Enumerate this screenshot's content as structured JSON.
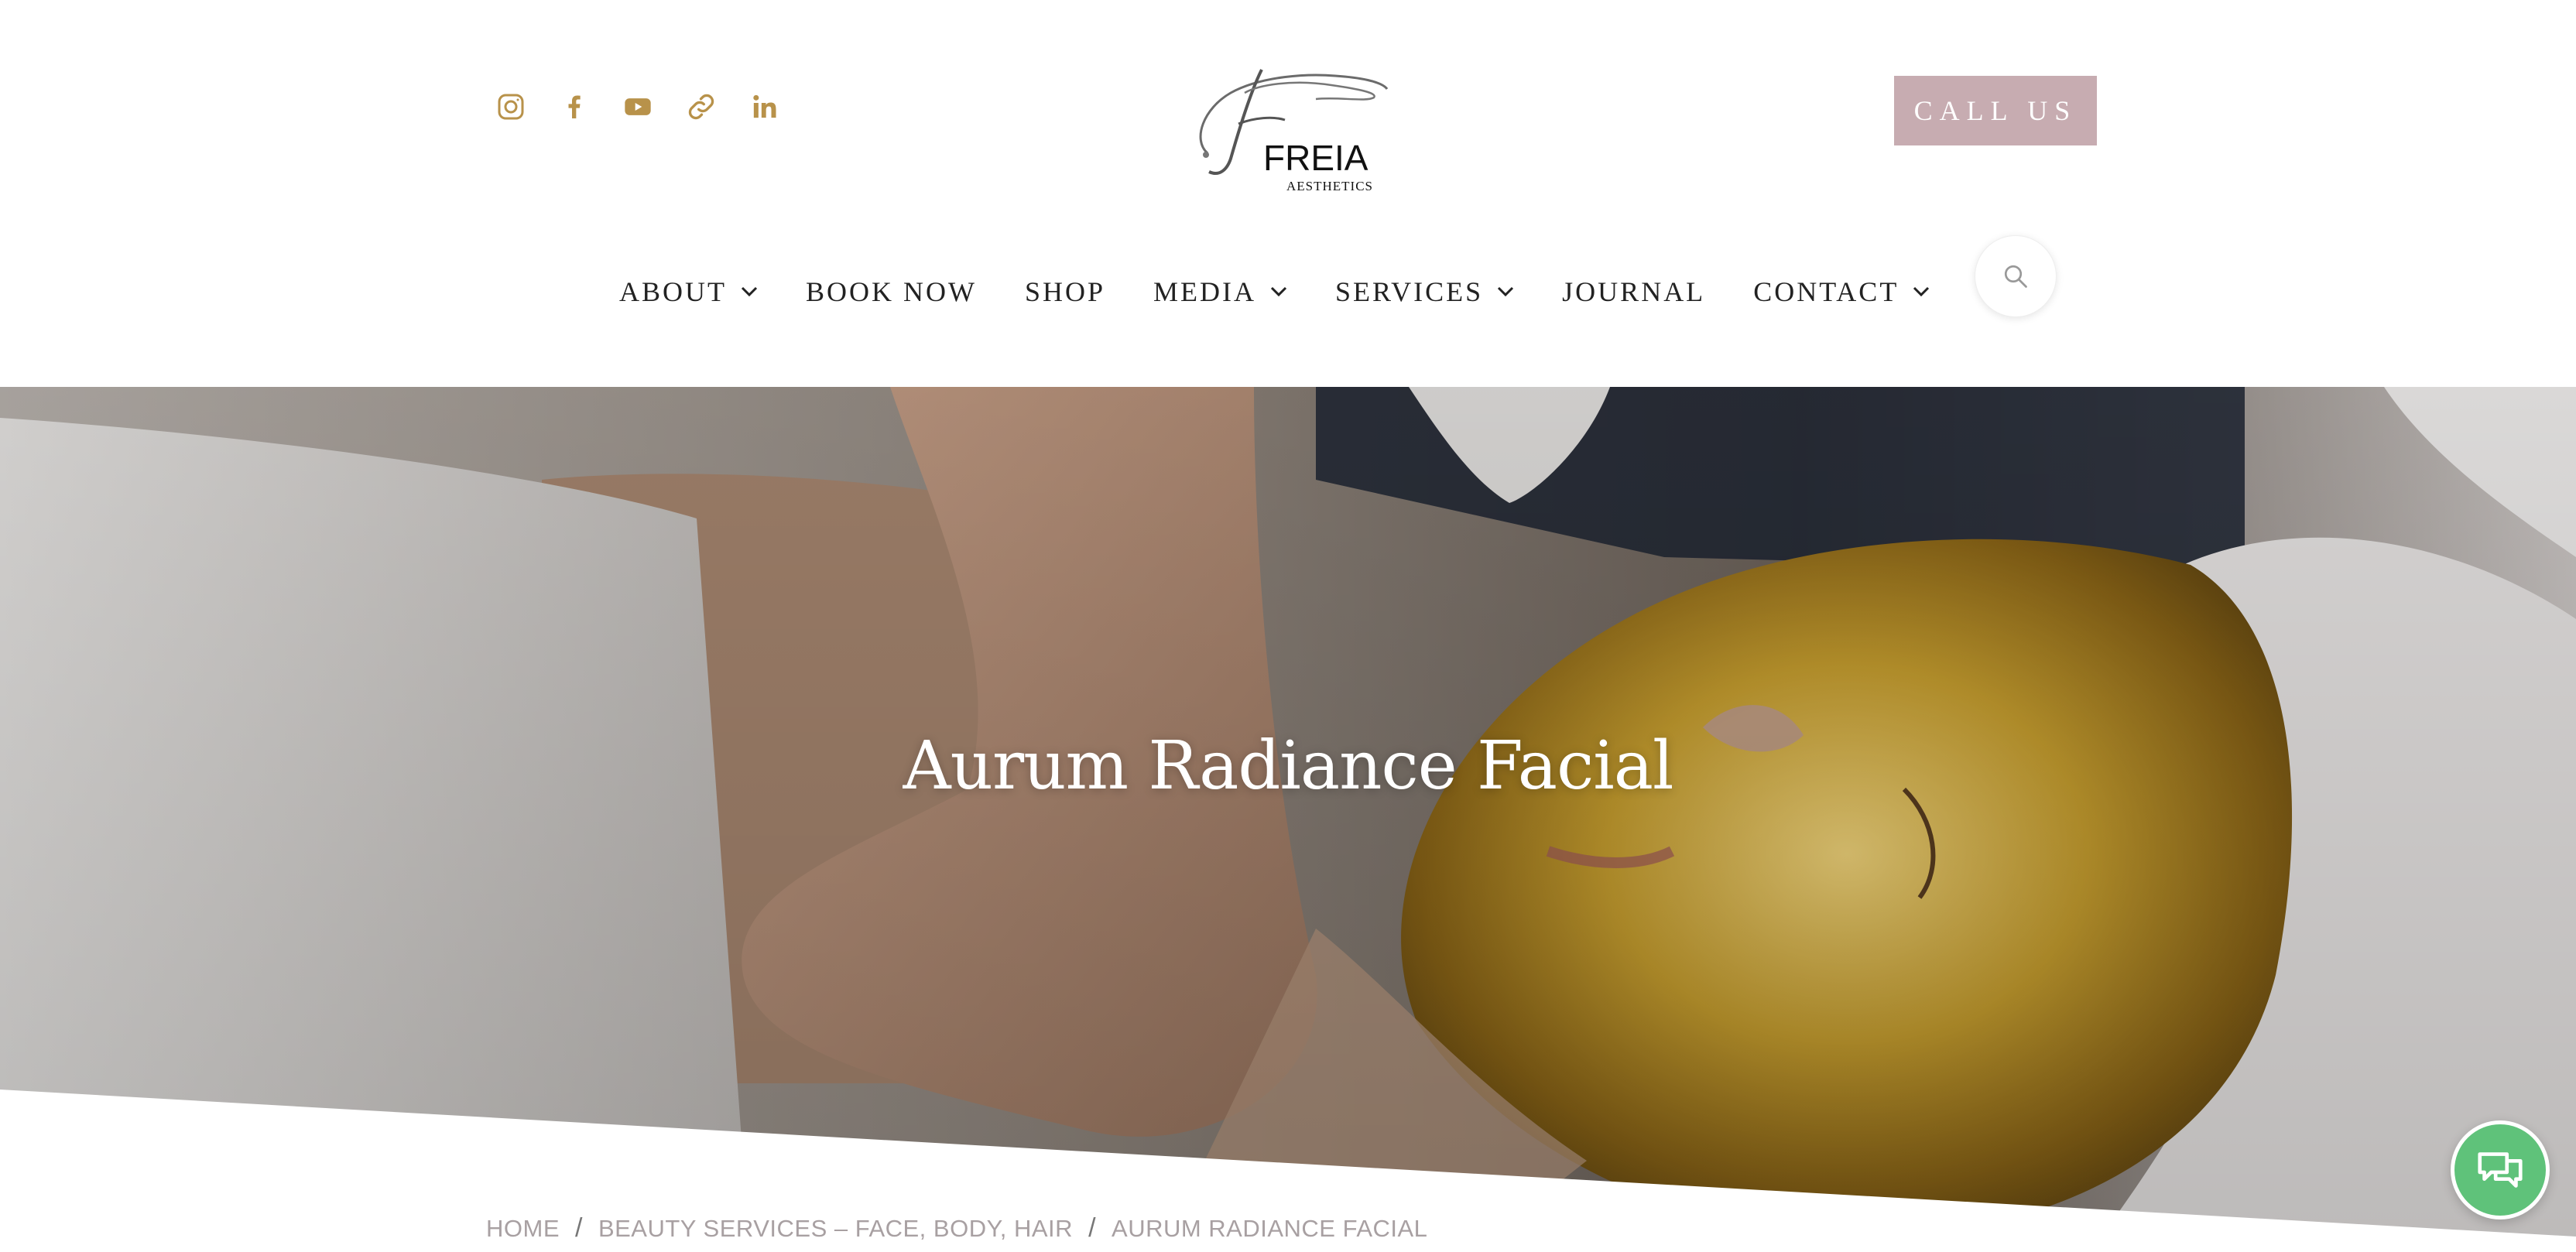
{
  "header": {
    "social_icons": [
      "instagram-icon",
      "facebook-icon",
      "youtube-icon",
      "link-icon",
      "linkedin-icon"
    ],
    "logo": {
      "brand": "FREIA",
      "tagline": "AESTHETICS"
    },
    "call_button": "CALL US"
  },
  "nav": {
    "items": [
      {
        "label": "ABOUT",
        "has_dropdown": true
      },
      {
        "label": "BOOK NOW",
        "has_dropdown": false
      },
      {
        "label": "SHOP",
        "has_dropdown": false
      },
      {
        "label": "MEDIA",
        "has_dropdown": true
      },
      {
        "label": "SERVICES",
        "has_dropdown": true
      },
      {
        "label": "JOURNAL",
        "has_dropdown": false
      },
      {
        "label": "CONTACT",
        "has_dropdown": true
      }
    ]
  },
  "hero": {
    "title": "Aurum Radiance Facial"
  },
  "breadcrumb": {
    "items": [
      "HOME",
      "BEAUTY SERVICES – FACE, BODY, HAIR",
      "AURUM RADIANCE FACIAL"
    ],
    "separator": "/"
  },
  "colors": {
    "accent_gold": "#b8924a",
    "call_button_bg": "#c7acb1",
    "chat_green": "#5fc27a",
    "breadcrumb_text": "#a8a0a2"
  }
}
